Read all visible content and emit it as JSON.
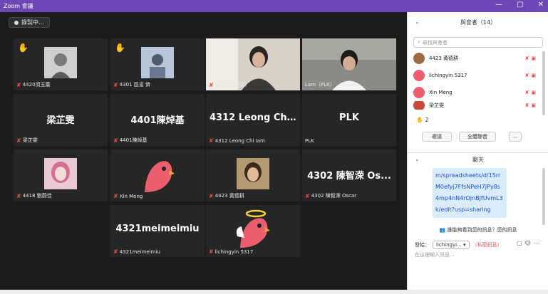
{
  "window": {
    "title": "Zoom 會議",
    "controls": [
      "—",
      "▢",
      "✕"
    ]
  },
  "recording": {
    "label": "錄製中..."
  },
  "tiles": [
    {
      "id": "t1",
      "name": "4420須玉蕾",
      "hand": true
    },
    {
      "id": "t2",
      "name": "4301 區浚 儕",
      "hand": true
    },
    {
      "id": "t3",
      "name": "何萍（社委試）",
      "hand": false
    },
    {
      "id": "t4",
      "name": "Lam（PLK）",
      "hand": false
    },
    {
      "id": "t5",
      "name": "梁芷雯",
      "big": "梁芷雯"
    },
    {
      "id": "t6",
      "name": "4401陳焯基",
      "big": "4401陳焯基"
    },
    {
      "id": "t7",
      "name": "4312 Leong Chi Iam",
      "big": "4312 Leong Chi..."
    },
    {
      "id": "t8",
      "name": "PLK",
      "big": "PLK"
    },
    {
      "id": "t9",
      "name": "4418 劉蔚佳"
    },
    {
      "id": "t10",
      "name": "Xin Meng"
    },
    {
      "id": "t11",
      "name": "4423 黃德耕"
    },
    {
      "id": "t12",
      "name": "4302 陳智溁 Oscar",
      "big": "4302 陳智溁 Os..."
    },
    {
      "id": "t13",
      "name": "4321meimeimiu",
      "big": "4321meimeimiu"
    },
    {
      "id": "t14",
      "name": "lichingyin 5317"
    }
  ],
  "panel": {
    "participants_title": "與會者（14）",
    "search_placeholder": "尋找與會者",
    "participants": [
      {
        "name": "4423 黃德耕"
      },
      {
        "name": "lichingyin 5317"
      },
      {
        "name": "Xin Meng"
      },
      {
        "name": "梁芷雯"
      }
    ],
    "raised_hands": "2",
    "invite_label": "邀請",
    "mute_all_label": "全體靜音",
    "more_label": "..",
    "chat_title": "聊天",
    "chat_message": "m/spreadsheets/d/15rrM0efyj7FfsNPeH7JPy8s4mp4nN4rOjnBJfUvmL3k/edit?usp=sharing",
    "notice": "誰能夠看到您的訊息？您的訊息",
    "send_to_label": "發給：",
    "send_to_value": "lichingyi...",
    "private_label": "（私密訊息）",
    "input_placeholder": "在這裡輸入訊息..."
  },
  "colors": {
    "titlebar": "#6e46b5",
    "active_speaker": "#9ad04a",
    "mute_red": "#e74c3c",
    "link_blue": "#1a4fcf"
  }
}
